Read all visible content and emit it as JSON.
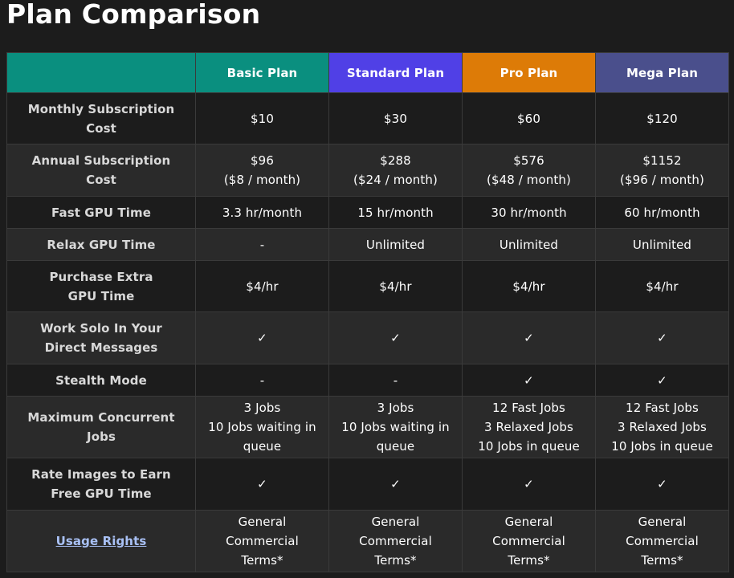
{
  "title": "Plan Comparison",
  "plans": [
    {
      "name": "Basic Plan",
      "color": "#0a8f7f"
    },
    {
      "name": "Standard Plan",
      "color": "#5040e6"
    },
    {
      "name": "Pro Plan",
      "color": "#dd7b07"
    },
    {
      "name": "Mega Plan",
      "color": "#4a4f8c"
    }
  ],
  "header_corner_color": "#0a8f7f",
  "rows": [
    {
      "label": [
        "Monthly Subscription",
        "Cost"
      ],
      "cells": [
        [
          "$10"
        ],
        [
          "$30"
        ],
        [
          "$60"
        ],
        [
          "$120"
        ]
      ]
    },
    {
      "label": [
        "Annual Subscription",
        "Cost"
      ],
      "cells": [
        [
          "$96",
          "($8 / month)"
        ],
        [
          "$288",
          "($24 / month)"
        ],
        [
          "$576",
          "($48 / month)"
        ],
        [
          "$1152",
          "($96 / month)"
        ]
      ]
    },
    {
      "label": [
        "Fast GPU Time"
      ],
      "cells": [
        [
          "3.3 hr/month"
        ],
        [
          "15 hr/month"
        ],
        [
          "30 hr/month"
        ],
        [
          "60 hr/month"
        ]
      ]
    },
    {
      "label": [
        "Relax GPU Time"
      ],
      "cells": [
        [
          "-"
        ],
        [
          "Unlimited"
        ],
        [
          "Unlimited"
        ],
        [
          "Unlimited"
        ]
      ]
    },
    {
      "label": [
        "Purchase Extra",
        "GPU Time"
      ],
      "cells": [
        [
          "$4/hr"
        ],
        [
          "$4/hr"
        ],
        [
          "$4/hr"
        ],
        [
          "$4/hr"
        ]
      ]
    },
    {
      "label": [
        "Work Solo In Your",
        "Direct Messages"
      ],
      "cells": [
        [
          "✓"
        ],
        [
          "✓"
        ],
        [
          "✓"
        ],
        [
          "✓"
        ]
      ]
    },
    {
      "label": [
        "Stealth Mode"
      ],
      "cells": [
        [
          "-"
        ],
        [
          "-"
        ],
        [
          "✓"
        ],
        [
          "✓"
        ]
      ]
    },
    {
      "label": [
        "Maximum Concurrent",
        "Jobs"
      ],
      "cells": [
        [
          "3 Jobs",
          "10 Jobs waiting in",
          "queue"
        ],
        [
          "3 Jobs",
          "10 Jobs waiting in",
          "queue"
        ],
        [
          "12 Fast Jobs",
          "3 Relaxed Jobs",
          "10 Jobs in queue"
        ],
        [
          "12 Fast Jobs",
          "3 Relaxed Jobs",
          "10 Jobs in queue"
        ]
      ]
    },
    {
      "label": [
        "Rate Images to Earn",
        "Free GPU Time"
      ],
      "cells": [
        [
          "✓"
        ],
        [
          "✓"
        ],
        [
          "✓"
        ],
        [
          "✓"
        ]
      ]
    },
    {
      "label": [
        "Usage Rights"
      ],
      "label_is_link": true,
      "cells": [
        [
          "General",
          "Commercial",
          "Terms*"
        ],
        [
          "General",
          "Commercial",
          "Terms*"
        ],
        [
          "General",
          "Commercial",
          "Terms*"
        ],
        [
          "General",
          "Commercial",
          "Terms*"
        ]
      ]
    }
  ],
  "link_color": "#a9c1f5"
}
